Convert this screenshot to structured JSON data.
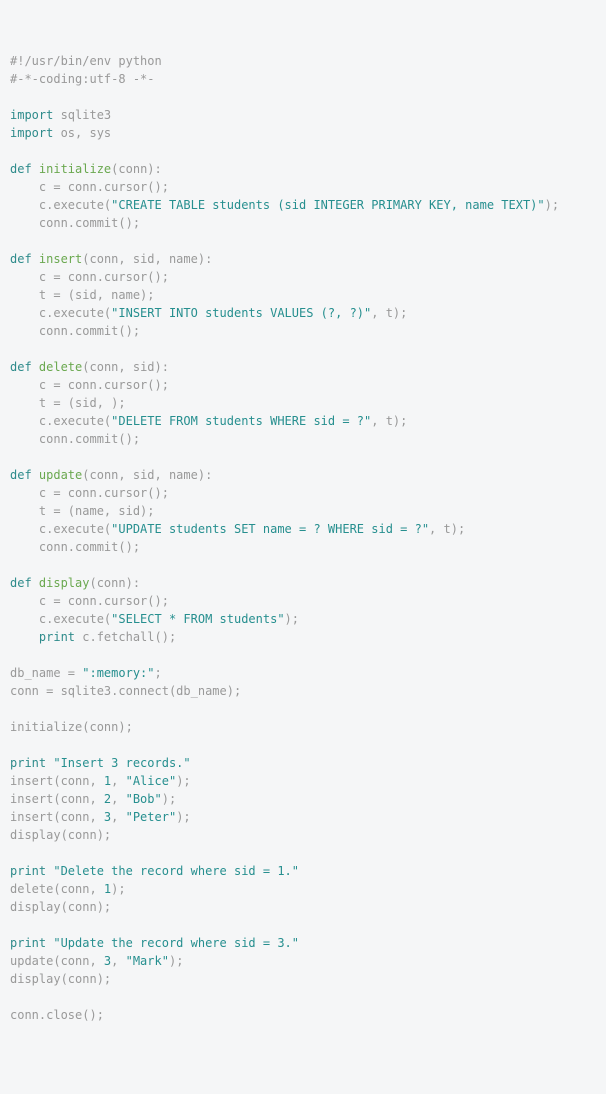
{
  "code": {
    "c1": "#!/usr/bin/env python",
    "c2": "#-*-coding:utf-8 -*-",
    "imp": "import",
    "sqlite3": " sqlite3",
    "os_sys": " os, sys",
    "def": "def",
    "print": "print",
    "fn_initialize": " initialize",
    "sig_initialize": "(conn):",
    "cursor_line": "    c = conn.cursor();",
    "exec_open": "    c.execute(",
    "sql_create": "\"CREATE TABLE students (sid INTEGER PRIMARY KEY, name TEXT)\"",
    "close_paren_semi": ");",
    "commit_line": "    conn.commit();",
    "fn_insert": " insert",
    "sig_insert": "(conn, sid, name):",
    "t_sid_name": "    t = (sid, name);",
    "sql_insert": "\"INSERT INTO students VALUES (?, ?)\"",
    "comma_t_close": ", t);",
    "fn_delete": " delete",
    "sig_delete": "(conn, sid):",
    "t_sid": "    t = (sid, );",
    "sql_delete": "\"DELETE FROM students WHERE sid = ?\"",
    "fn_update": " update",
    "sig_update": "(conn, sid, name):",
    "t_name_sid": "    t = (name, sid);",
    "sql_update": "\"UPDATE students SET name = ? WHERE sid = ?\"",
    "fn_display": " display",
    "sig_display": "(conn):",
    "sql_select": "\"SELECT * FROM students\"",
    "indent": "    ",
    "fetchall": " c.fetchall();",
    "dbname_pre": "db_name = ",
    "memory": "\":memory:\"",
    "semi": ";",
    "conn_connect": "conn = sqlite3.connect(db_name);",
    "call_initialize": "initialize(conn);",
    "str_ins3": " \"Insert 3 records.\"",
    "insert_pre": "insert(conn, ",
    "one": "1",
    "two": "2",
    "three": "3",
    "comma_sp": ", ",
    "alice": "\"Alice\"",
    "bob": "\"Bob\"",
    "peter": "\"Peter\"",
    "mark": "\"Mark\"",
    "call_display": "display(conn);",
    "str_del1": " \"Delete the record where sid = 1.\"",
    "delete_call": "delete(conn, ",
    "str_upd3": " \"Update the record where sid = 3.\"",
    "update_call": "update(conn, ",
    "conn_close": "conn.close();"
  }
}
